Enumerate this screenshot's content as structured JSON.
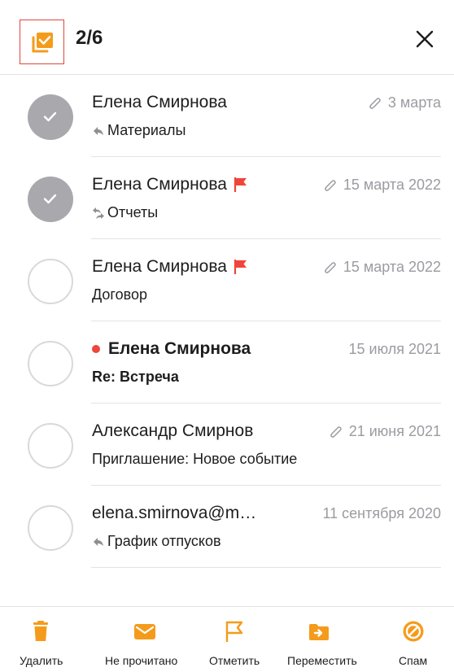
{
  "header": {
    "selection_count": "2/6"
  },
  "colors": {
    "accent": "#f59b1b",
    "flag": "#f0453a",
    "unread_dot": "#f0453a",
    "checked_avatar": "#a8a8ad",
    "meta_text": "#9b9ba1"
  },
  "messages": [
    {
      "sender": "Елена Смирнова",
      "date": "3 марта",
      "subject": "Материалы",
      "selected": true,
      "attachment": true,
      "flagged": false,
      "unread": false,
      "subject_icon": "reply-icon"
    },
    {
      "sender": "Елена Смирнова",
      "date": "15 марта 2022",
      "subject": "Отчеты",
      "selected": true,
      "attachment": true,
      "flagged": true,
      "unread": false,
      "subject_icon": "reply-forward-icon"
    },
    {
      "sender": "Елена Смирнова",
      "date": "15 марта 2022",
      "subject": "Договор",
      "selected": false,
      "attachment": true,
      "flagged": true,
      "unread": false,
      "subject_icon": ""
    },
    {
      "sender": "Елена Смирнова",
      "date": "15 июля 2021",
      "subject": "Re: Встреча",
      "selected": false,
      "attachment": false,
      "flagged": false,
      "unread": true,
      "subject_icon": ""
    },
    {
      "sender": "Александр Смирнов",
      "date": "21 июня 2021",
      "subject": "Приглашение: Новое событие",
      "selected": false,
      "attachment": true,
      "flagged": false,
      "unread": false,
      "subject_icon": ""
    },
    {
      "sender": "elena.smirnova@m…",
      "date": "11 сентября 2020",
      "subject": "График отпусков",
      "selected": false,
      "attachment": false,
      "flagged": false,
      "unread": false,
      "subject_icon": "reply-icon"
    }
  ],
  "toolbar": {
    "items": [
      {
        "label": "Удалить",
        "icon": "trash-icon"
      },
      {
        "label": "Не прочитано",
        "icon": "envelope-icon"
      },
      {
        "label": "Отметить",
        "icon": "flag-icon"
      },
      {
        "label": "Переместить",
        "icon": "move-folder-icon"
      },
      {
        "label": "Спам",
        "icon": "spam-icon"
      }
    ]
  }
}
